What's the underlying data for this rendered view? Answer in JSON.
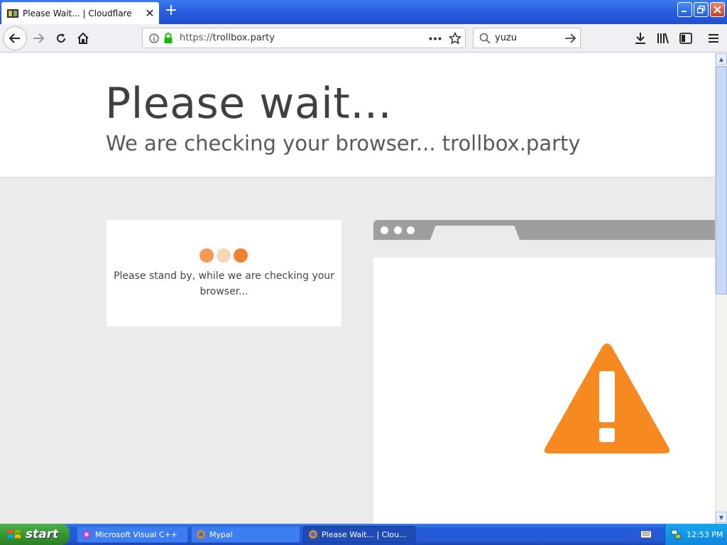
{
  "browser": {
    "tab": {
      "title": "Please Wait... | Cloudflare",
      "close": "✕"
    },
    "new_tab": "+",
    "url": {
      "scheme": "https://",
      "host": "trollbox.party"
    },
    "search": {
      "value": "yuzu"
    }
  },
  "page": {
    "title": "Please wait...",
    "subtitle": "We are checking your browser... trollbox.party",
    "standby_line1": "Please stand by, while we are checking your",
    "standby_line2": "browser...",
    "colors": {
      "orange": "#f6891f",
      "dot1": "#f59a50",
      "dot2": "#f7d6b4",
      "dot3": "#f0822f"
    }
  },
  "taskbar": {
    "start": "start",
    "tasks": [
      {
        "label": "Microsoft Visual C++"
      },
      {
        "label": "Mypal"
      },
      {
        "label": "Please Wait... | Clou..."
      }
    ],
    "clock": "12:53 PM"
  }
}
